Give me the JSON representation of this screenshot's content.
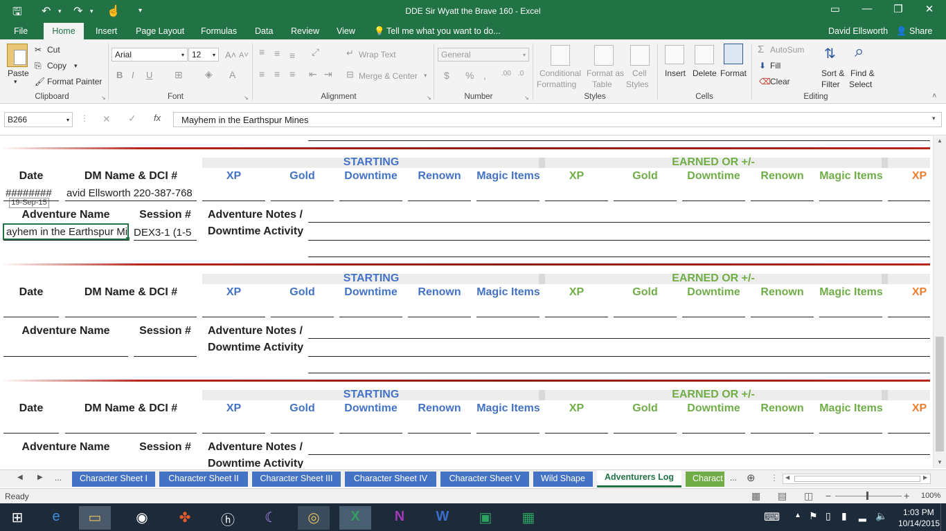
{
  "window": {
    "title": "DDE Sir Wyatt the Brave 160 - Excel",
    "user": "David Ellsworth",
    "share": "Share"
  },
  "ribbon_tabs": [
    "File",
    "Home",
    "Insert",
    "Page Layout",
    "Formulas",
    "Data",
    "Review",
    "View"
  ],
  "tell_me": "Tell me what you want to do...",
  "clipboard": {
    "paste": "Paste",
    "cut": "Cut",
    "copy": "Copy",
    "format_painter": "Format Painter",
    "label": "Clipboard"
  },
  "font": {
    "name": "Arial",
    "size": "12",
    "label": "Font"
  },
  "alignment": {
    "wrap": "Wrap Text",
    "merge": "Merge & Center",
    "label": "Alignment"
  },
  "number": {
    "format": "General",
    "label": "Number"
  },
  "styles": {
    "cond1": "Conditional",
    "cond2": "Formatting",
    "fmt1": "Format as",
    "fmt2": "Table",
    "cell1": "Cell",
    "cell2": "Styles",
    "label": "Styles"
  },
  "cells": {
    "insert": "Insert",
    "delete": "Delete",
    "format": "Format",
    "label": "Cells"
  },
  "editing": {
    "autosum": "AutoSum",
    "fill": "Fill",
    "clear": "Clear",
    "sort1": "Sort &",
    "sort2": "Filter",
    "find1": "Find &",
    "find2": "Select",
    "label": "Editing"
  },
  "formula_bar": {
    "name_box": "B266",
    "fx": "fx",
    "content": "Mayhem in the Earthspur Mines"
  },
  "log": {
    "starting": "STARTING",
    "earned": "EARNED OR +/-",
    "date": "Date",
    "dm": "DM Name & DCI #",
    "adventure_name": "Adventure Name",
    "session": "Session #",
    "notes1": "Adventure Notes /",
    "notes2": "Downtime Activity",
    "cols_start": [
      "XP",
      "Gold",
      "Downtime",
      "Renown",
      "Magic Items"
    ],
    "cols_earned": [
      "XP",
      "Gold",
      "Downtime",
      "Renown",
      "Magic Items"
    ],
    "col_extra": "XP",
    "entry1": {
      "date": "########",
      "date_tooltip": "19-Sep-15",
      "dm": "avid Ellsworth 220-387-768",
      "adventure": "ayhem in the Earthspur Min",
      "session": "DEX3-1 (1-5"
    }
  },
  "sheet_tabs": [
    "Character Sheet I",
    "Character Sheet II",
    "Character Sheet III",
    "Character Sheet IV",
    "Character Sheet V",
    "Wild Shape",
    "Adventurers Log",
    "Charact"
  ],
  "active_sheet": "Adventurers Log",
  "status": {
    "ready": "Ready",
    "zoom": "100%"
  },
  "clock": {
    "time": "1:03 PM",
    "date": "10/14/2015"
  },
  "colors": {
    "excel_green": "#217346",
    "header_blue": "#4472c4",
    "header_green": "#70ad47",
    "accent_orange": "#ed7d31"
  }
}
